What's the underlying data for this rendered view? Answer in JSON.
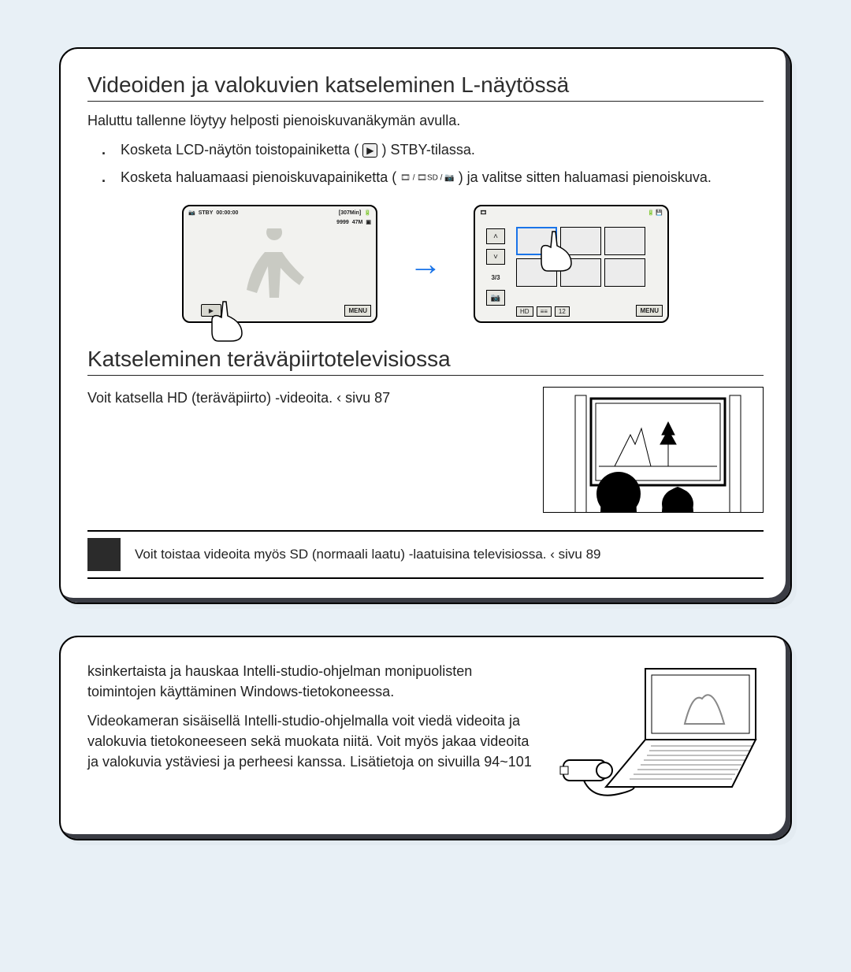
{
  "section1": {
    "heading": "Videoiden ja valokuvien katseleminen L-näytössä",
    "intro": "Haluttu tallenne löytyy helposti pienoiskuvanäkymän avulla.",
    "step1_a": "Kosketa LCD-näytön toistopainiketta (",
    "step1_b": ") STBY-tilassa.",
    "step2_a": "Kosketa haluamaasi pienoiskuvapainiketta (",
    "step2_b": ") ja valitse sitten haluamasi pienoiskuva.",
    "play_icon": "▶",
    "thumb_icons": "🎞 / 🎞SD / 📷",
    "screen1": {
      "stby": "STBY",
      "time": "00:00:00",
      "remain": "[307Min]",
      "count": "9999",
      "size": "47M",
      "menu": "MENU"
    },
    "screen2": {
      "page": "3/3",
      "menu": "MENU",
      "tb1": "HD",
      "tb2": "≡≡",
      "tb3": "12"
    },
    "hd_heading": "Katseleminen teräväpiirtotelevisiossa",
    "hd_text": "Voit katsella HD (teräväpiirto) -videoita.  ‹ sivu 87",
    "note": "Voit toistaa videoita myös SD (normaali laatu) -laatuisina televisiossa.  ‹ sivu 89"
  },
  "section2": {
    "lead": "ksinkertaista ja hauskaa Intelli-studio-ohjelman monipuolisten toimintojen käyttäminen Windows-tietokoneessa.",
    "body": "Videokameran sisäisellä Intelli-studio-ohjelmalla voit viedä videoita ja valokuvia tietokoneeseen sekä muokata niitä. Voit myös jakaa videoita ja valokuvia ystäviesi ja perheesi kanssa. Lisätietoja on sivuilla 94~101"
  }
}
